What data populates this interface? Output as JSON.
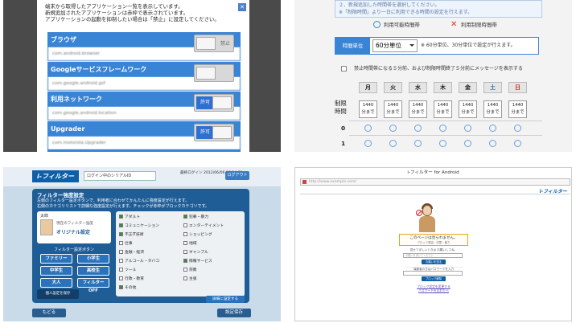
{
  "app_list": {
    "header_lines": [
      "端末から取得したアプリケーション一覧を表示しています。",
      "新規追加されたアプリケーションは赤枠で表示されています。",
      "アプリケーションの起動を抑制したい場合は「禁止」に設定してください。"
    ],
    "close_glyph": "✕",
    "apps": [
      {
        "name": "ブラウザ",
        "package": "com.android.browser",
        "state": "禁止",
        "allowed": false
      },
      {
        "name": "Googleサービスフレームワーク",
        "package": "com.google.android.gsf",
        "state": "",
        "allowed": false
      },
      {
        "name": "利用ネットワーク",
        "package": "com.google.android.location",
        "state": "許可",
        "allowed": true
      },
      {
        "name": "Upgrader",
        "package": "com.motorola.Upgrader",
        "state": "許可",
        "allowed": true
      }
    ]
  },
  "time_limit": {
    "top_line_1": "２．新規追加した時間帯を選択してください。",
    "top_line_2": "※「制限時間」より一日に利用できる時間の設定を行えます。",
    "legend_ok": "利用可能時間帯",
    "legend_ng": "利用制限時間帯",
    "unit_tag": "時間単位",
    "unit_value": "60分単位",
    "unit_note": "※ 60分単位、30分単位で設定が行えます。",
    "checkbox_label": "禁止時間帯になる５分前、および制限時間終了５分前にメッセージを表示する",
    "days": [
      "月",
      "火",
      "水",
      "木",
      "金",
      "土",
      "日"
    ],
    "limit_label_1": "制限",
    "limit_label_2": "時間",
    "limit_value": "1440",
    "limit_unit": "分まで",
    "hour_rows": [
      "0",
      "1"
    ]
  },
  "filter_settings": {
    "logo": "i-フィルター",
    "account_field": "ログイン中のシリアルID",
    "time_label": "最終ログイン 2012/06/06 16:14:51",
    "logout": "ログアウト",
    "title": "フィルター強度設定",
    "desc_1": "左側のフィルター設定ボタンで、利用者に合わせてかんたんに強度設定が行えます。",
    "desc_2": "右側のカテゴリリストで詳細な強度設定が行えます。チェックが赤枠がブロックカテゴリです。",
    "user_name": "太郎",
    "user_line_1": "現在のフィルター強度",
    "user_line_2": "オリジナル設定",
    "button_section_title": "フィルター設定ボタン",
    "preset_buttons": [
      "ファミリー",
      "小学生",
      "中学生",
      "高校生",
      "大人",
      "フィルターOFF"
    ],
    "save_page_button": "個人設定を保存",
    "categories_left": [
      "アダルト",
      "コミュニケーション",
      "不正IT技術",
      "仕事",
      "金融・経済",
      "アルコール・タバコ",
      "ツール",
      "行政・教育",
      "その他"
    ],
    "categories_left_checked": [
      true,
      true,
      true,
      false,
      false,
      false,
      false,
      false,
      true
    ],
    "categories_right": [
      "犯罪・暴力",
      "エンターテイメント",
      "ショッピング",
      "地域",
      "ギャンブル",
      "情報サービス",
      "宗教",
      "主張"
    ],
    "categories_right_checked": [
      true,
      false,
      false,
      false,
      false,
      true,
      false,
      false
    ],
    "detail_button": "詳細に設定する",
    "back_button": "もどる",
    "save_button": "設定保存"
  },
  "block_page": {
    "window_title": "i-フィルター for Android",
    "address": "http://www.example.com/",
    "brand": "i-フィルター",
    "message_1": "このページは見られません。",
    "message_2": "ブロック理由：犯罪・暴力",
    "ask_label": "見せてほしいときは お願いしてね。",
    "input_placeholder": "お願いを書いてください",
    "request_button": "お願いを送る",
    "password_label": "保護者の方はパスワードを入力",
    "unblock_button": "ブロック解除",
    "links": [
      "ブロック設定を変更する",
      "パスワードを忘れたら"
    ]
  }
}
